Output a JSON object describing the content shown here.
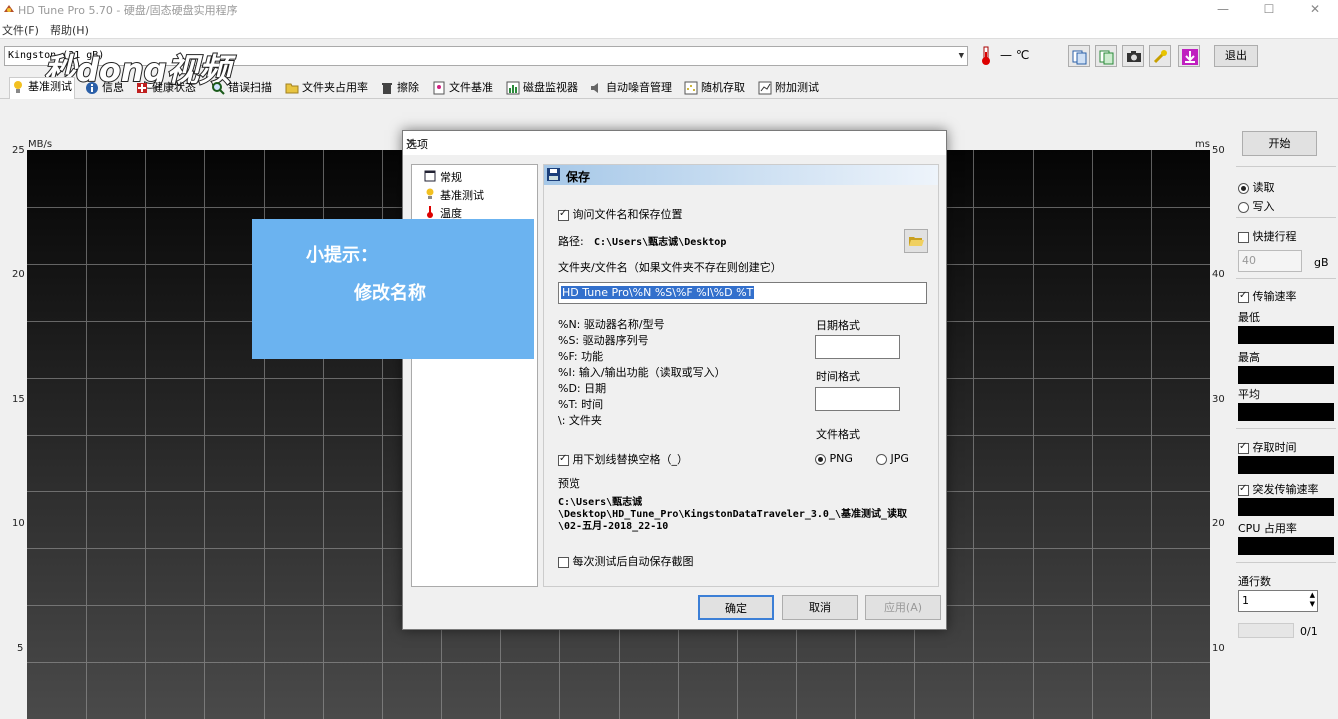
{
  "window": {
    "title": "HD Tune Pro 5.70 - 硬盘/固态硬盘实用程序"
  },
  "menu": {
    "file": "文件(F)",
    "help": "帮助(H)"
  },
  "toolbar": {
    "drive": "Kingston  (31 gB)",
    "temperature": "— ℃",
    "exit_label": "退出"
  },
  "watermark": "秒dong视频",
  "tabs": [
    {
      "label": "基准测试"
    },
    {
      "label": "信息"
    },
    {
      "label": "健康状态"
    },
    {
      "label": "错误扫描"
    },
    {
      "label": "文件夹占用率"
    },
    {
      "label": "擦除"
    },
    {
      "label": "文件基准"
    },
    {
      "label": "磁盘监视器"
    },
    {
      "label": "自动噪音管理"
    },
    {
      "label": "随机存取"
    },
    {
      "label": "附加测试"
    }
  ],
  "chart": {
    "left_unit": "MB/s",
    "right_unit": "ms",
    "left_ticks": [
      "25",
      "20",
      "15",
      "10",
      "5"
    ],
    "right_ticks": [
      "50",
      "40",
      "30",
      "20",
      "10"
    ]
  },
  "right_panel": {
    "start_label": "开始",
    "read_label": "读取",
    "write_label": "写入",
    "short_stroke_label": "快捷行程",
    "short_stroke_value": "40",
    "short_stroke_unit": "gB",
    "transfer_rate_label": "传输速率",
    "min_label": "最低",
    "max_label": "最高",
    "avg_label": "平均",
    "access_time_label": "存取时间",
    "burst_rate_label": "突发传输速率",
    "cpu_label": "CPU 占用率",
    "passes_label": "通行数",
    "passes_value": "1",
    "progress_text": "0/1"
  },
  "tip": {
    "line1": "小提示：",
    "line2": "修改名称"
  },
  "dialog": {
    "title": "选项",
    "tree": [
      "常规",
      "基准测试",
      "温度"
    ],
    "section_title": "保存",
    "ask_filename_label": "询问文件名和保存位置",
    "path_label": "路径:",
    "path_value": "C:\\Users\\甄志诚\\Desktop",
    "folder_file_label": "文件夹/文件名（如果文件夹不存在则创建它）",
    "filename_pattern": "HD Tune Pro\\%N %S\\%F %I\\%D %T",
    "legend": [
      "%N: 驱动器名称/型号",
      "%S: 驱动器序列号",
      "%F: 功能",
      "%I: 输入/输出功能（读取或写入）",
      "%D: 日期",
      "%T: 时间",
      "\\: 文件夹"
    ],
    "date_format_label": "日期格式",
    "time_format_label": "时间格式",
    "file_format_label": "文件格式",
    "png_label": "PNG",
    "jpg_label": "JPG",
    "underscore_label": "用下划线替换空格（_）",
    "preview_label": "预览",
    "preview_lines": [
      "C:\\Users\\甄志诚",
      "\\Desktop\\HD_Tune_Pro\\KingstonDataTraveler_3.0_\\基准测试_读取",
      "\\02-五月-2018_22-10"
    ],
    "auto_save_label": "每次测试后自动保存截图",
    "ok_label": "确定",
    "cancel_label": "取消",
    "apply_label": "应用(A)"
  }
}
